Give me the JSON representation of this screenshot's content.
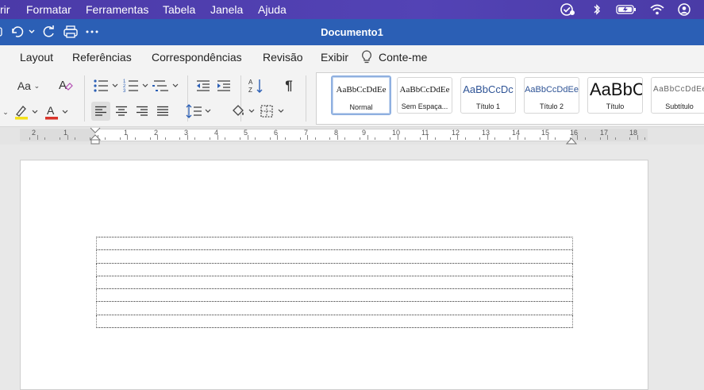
{
  "menubar": {
    "items": [
      "rir",
      "Formatar",
      "Ferramentas",
      "Tabela",
      "Janela",
      "Ajuda"
    ],
    "status_icons": [
      "focus-check-icon",
      "bluetooth-icon",
      "battery-charging-icon",
      "wifi-icon",
      "user-account-icon"
    ]
  },
  "window": {
    "title": "Documento1",
    "quick_access": [
      "sidebar-icon",
      "undo-icon",
      "redo-icon",
      "print-icon",
      "more-icon"
    ]
  },
  "ribbon_tabs": [
    "Layout",
    "Referências",
    "Correspondências",
    "Revisão",
    "Exibir",
    "Conte-me"
  ],
  "ribbon": {
    "font_size_button": "Aa",
    "paragraph_mark": "¶",
    "font_color": "#d9342b",
    "highlight_color": "#f5e11a"
  },
  "styles": [
    {
      "sample": "AaBbCcDdEe",
      "name": "Normal"
    },
    {
      "sample": "AaBbCcDdEe",
      "name": "Sem Espaça..."
    },
    {
      "sample": "AaBbCcDc",
      "name": "Título 1"
    },
    {
      "sample": "AaBbCcDdEe",
      "name": "Título 2"
    },
    {
      "sample": "AaBbC",
      "name": "Título"
    },
    {
      "sample": "AaBbCcDdEe",
      "name": "Subtítulo"
    }
  ],
  "ruler": {
    "numbers": [
      "2",
      "1",
      "1",
      "2",
      "3",
      "4",
      "5",
      "6",
      "7",
      "8",
      "9",
      "10",
      "11",
      "12",
      "13",
      "14",
      "15",
      "16",
      "17",
      "18"
    ]
  },
  "document": {
    "table_rows": 7,
    "table_cols": 1
  }
}
